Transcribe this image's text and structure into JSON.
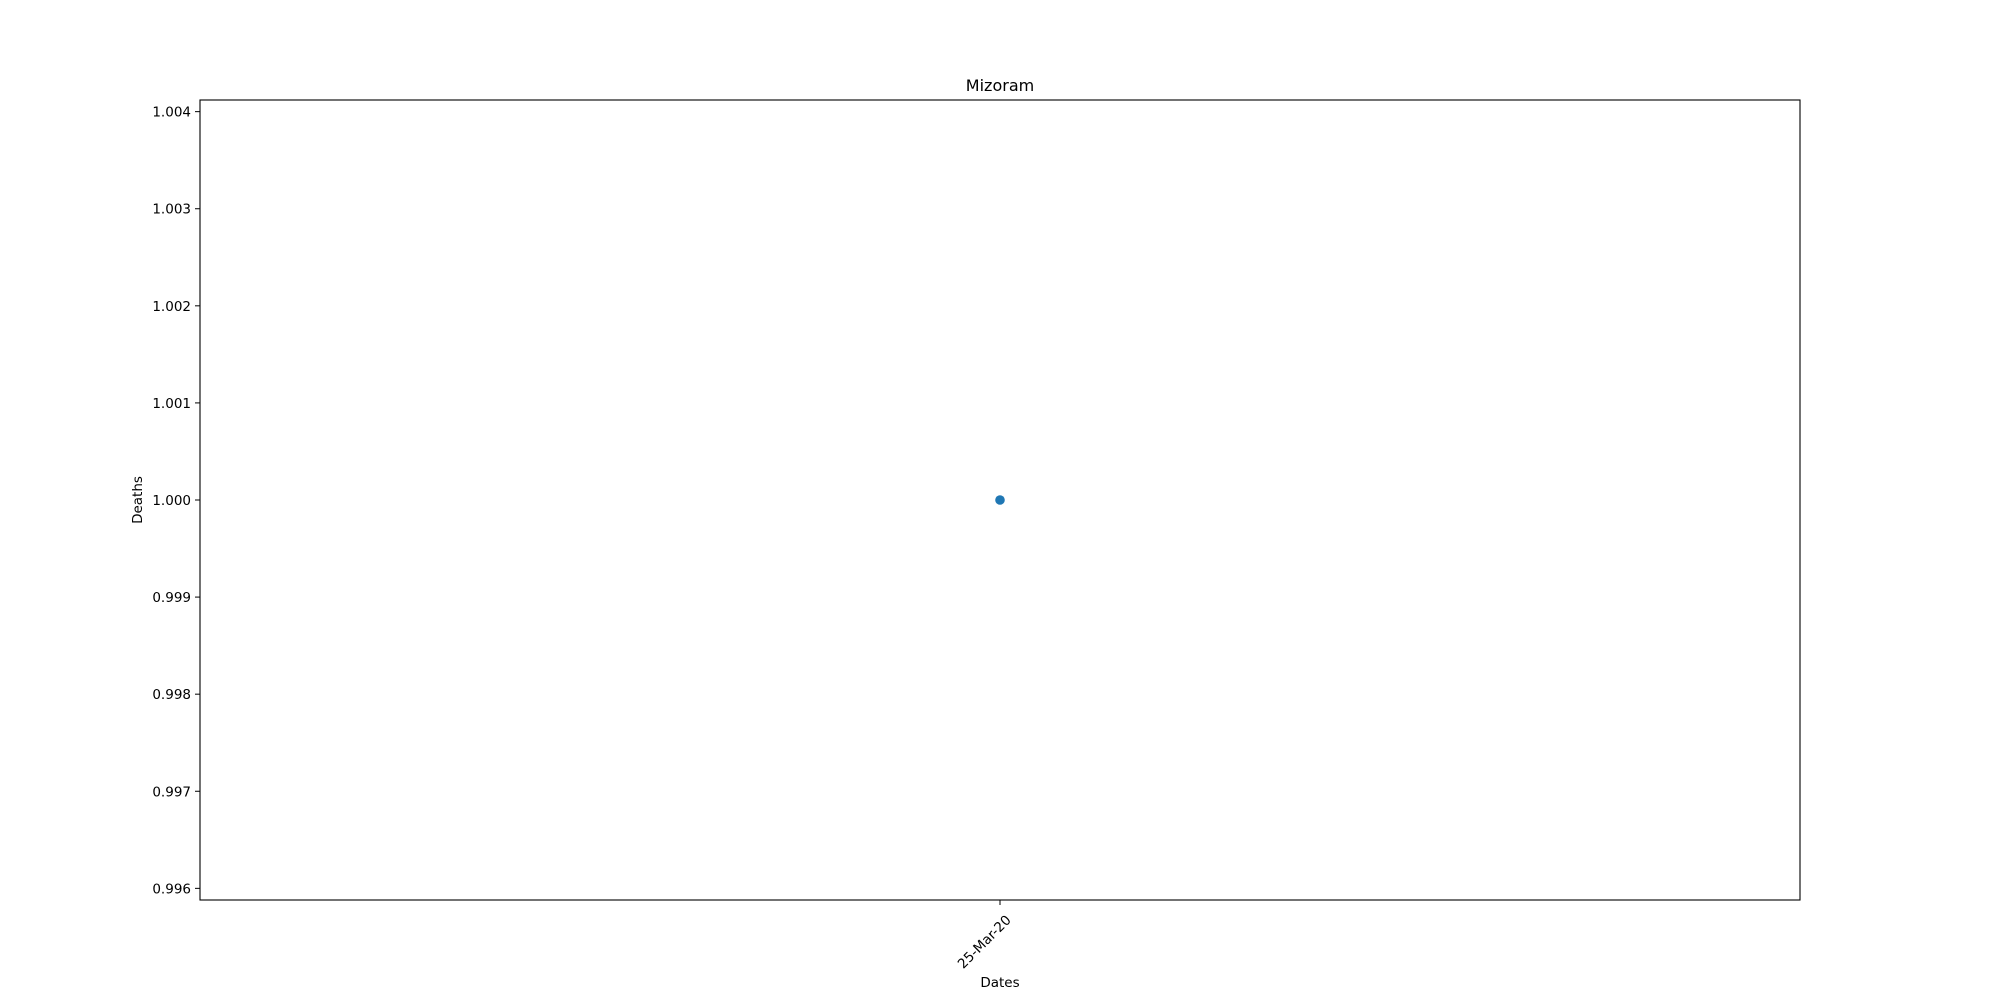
{
  "chart_data": {
    "type": "scatter",
    "title": "Mizoram",
    "xlabel": "Dates",
    "ylabel": "Deaths",
    "x_ticks": [
      "25-Mar-20"
    ],
    "y_ticks": [
      "0.996",
      "0.997",
      "0.998",
      "0.999",
      "1.000",
      "1.001",
      "1.002",
      "1.003",
      "1.004"
    ],
    "ylim": [
      0.99588,
      1.00412
    ],
    "grid": false,
    "points": [
      {
        "x": "25-Mar-20",
        "y": 1.0
      }
    ],
    "colors": {
      "marker": "#1f77b4",
      "axes": "#000000"
    }
  }
}
